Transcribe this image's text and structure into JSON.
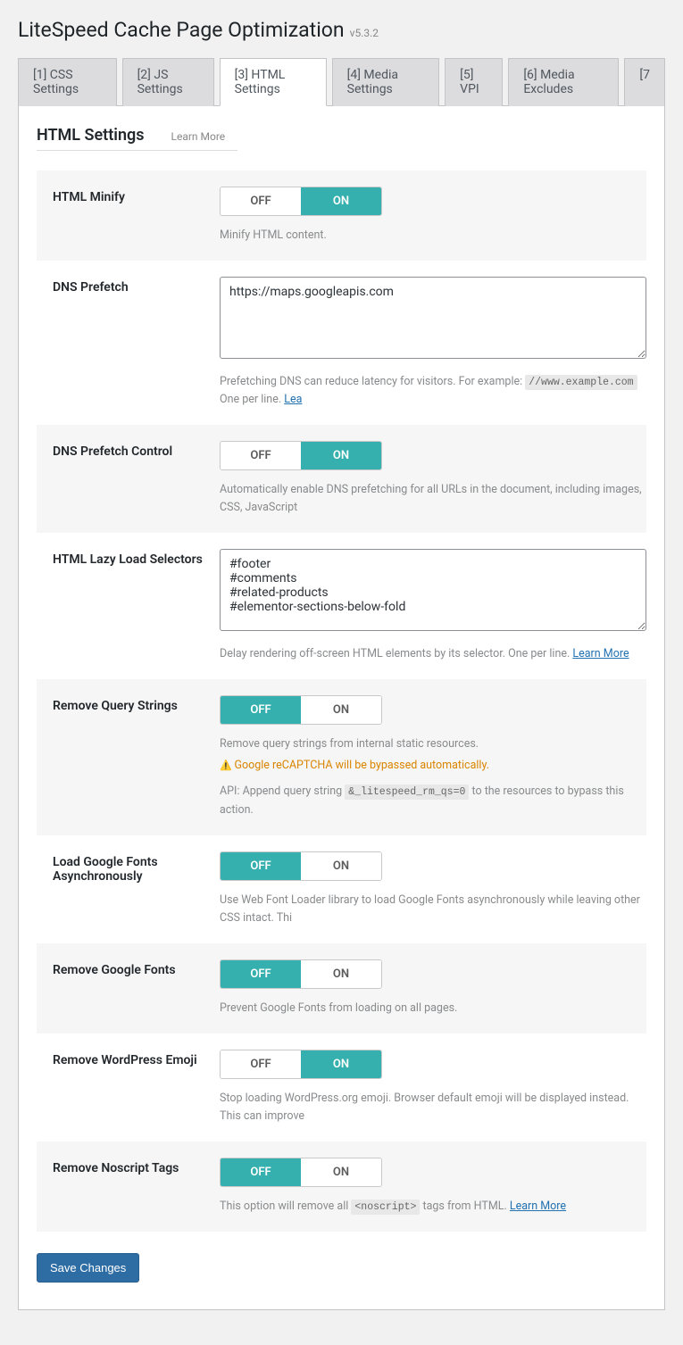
{
  "header": {
    "title": "LiteSpeed Cache Page Optimization",
    "version": "v5.3.2"
  },
  "tabs": [
    {
      "label": "[1] CSS Settings",
      "active": false
    },
    {
      "label": "[2] JS Settings",
      "active": false
    },
    {
      "label": "[3] HTML Settings",
      "active": true
    },
    {
      "label": "[4] Media Settings",
      "active": false
    },
    {
      "label": "[5] VPI",
      "active": false
    },
    {
      "label": "[6] Media Excludes",
      "active": false
    },
    {
      "label": "[7",
      "active": false
    }
  ],
  "section": {
    "title": "HTML Settings",
    "learn_more": "Learn More"
  },
  "toggle_labels": {
    "off": "OFF",
    "on": "ON"
  },
  "rows": {
    "html_minify": {
      "label": "HTML Minify",
      "value": "on",
      "desc": "Minify HTML content."
    },
    "dns_prefetch": {
      "label": "DNS Prefetch",
      "value": "https://maps.googleapis.com",
      "desc_pre": "Prefetching DNS can reduce latency for visitors. For example: ",
      "desc_code": "//www.example.com",
      "desc_post": " One per line. ",
      "desc_link": "Lea"
    },
    "dns_prefetch_control": {
      "label": "DNS Prefetch Control",
      "value": "on",
      "desc": "Automatically enable DNS prefetching for all URLs in the document, including images, CSS, JavaScript"
    },
    "html_lazy": {
      "label": "HTML Lazy Load Selectors",
      "value": "#footer\n#comments\n#related-products\n#elementor-sections-below-fold",
      "desc_pre": "Delay rendering off-screen HTML elements by its selector. One per line. ",
      "desc_link": "Learn More"
    },
    "remove_query": {
      "label": "Remove Query Strings",
      "value": "off",
      "desc": "Remove query strings from internal static resources.",
      "warn": "Google reCAPTCHA will be bypassed automatically.",
      "api_pre": "API: Append query string ",
      "api_code": "&_litespeed_rm_qs=0",
      "api_post": " to the resources to bypass this action."
    },
    "google_fonts_async": {
      "label": "Load Google Fonts Asynchronously",
      "value": "off",
      "desc": "Use Web Font Loader library to load Google Fonts asynchronously while leaving other CSS intact. Thi"
    },
    "remove_google_fonts": {
      "label": "Remove Google Fonts",
      "value": "off",
      "desc": "Prevent Google Fonts from loading on all pages."
    },
    "remove_wp_emoji": {
      "label": "Remove WordPress Emoji",
      "value": "on",
      "desc": "Stop loading WordPress.org emoji. Browser default emoji will be displayed instead. This can improve"
    },
    "remove_noscript": {
      "label": "Remove Noscript Tags",
      "value": "off",
      "desc_pre": "This option will remove all ",
      "desc_code": "<noscript>",
      "desc_post": " tags from HTML. ",
      "desc_link": "Learn More"
    }
  },
  "save_button": "Save Changes"
}
